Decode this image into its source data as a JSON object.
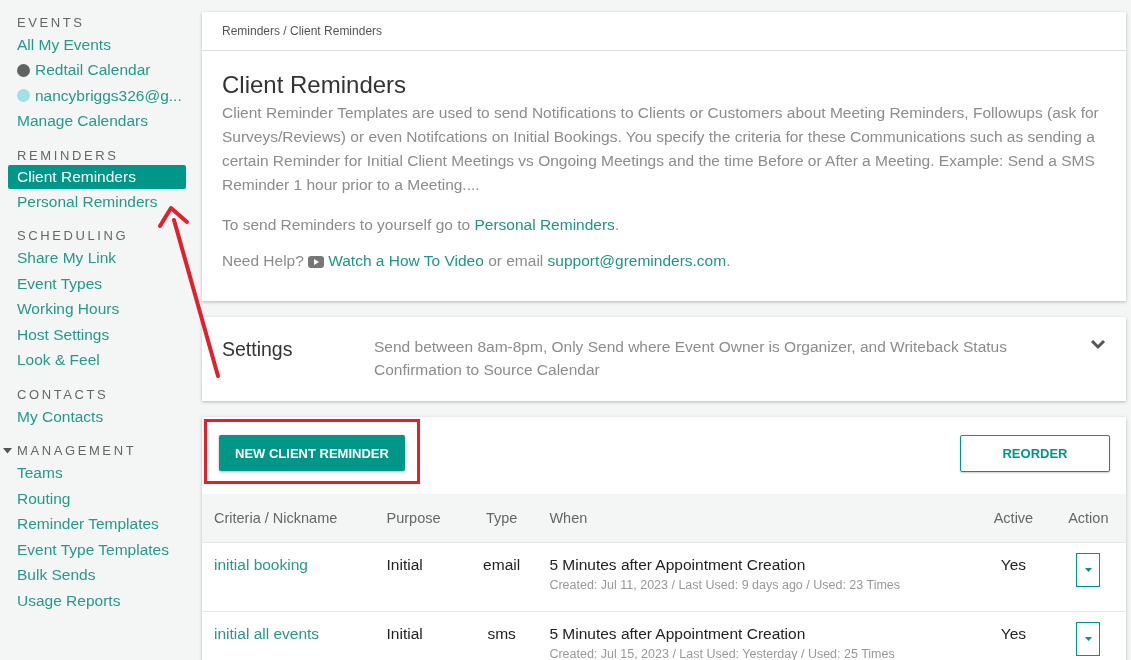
{
  "sidebar": {
    "sections": [
      {
        "heading": "EVENTS",
        "items": [
          {
            "label": "All My Events",
            "selected": false
          },
          {
            "label": "Redtail Calendar",
            "selected": false,
            "color": "#616161"
          },
          {
            "label": "nancybriggs326@g...",
            "selected": false,
            "color": "#a0e1e8"
          },
          {
            "label": "Manage Calendars",
            "selected": false
          }
        ]
      },
      {
        "heading": "REMINDERS",
        "items": [
          {
            "label": "Client Reminders",
            "selected": true
          },
          {
            "label": "Personal Reminders",
            "selected": false
          }
        ]
      },
      {
        "heading": "SCHEDULING",
        "items": [
          {
            "label": "Share My Link",
            "selected": false
          },
          {
            "label": "Event Types",
            "selected": false
          },
          {
            "label": "Working Hours",
            "selected": false
          },
          {
            "label": "Host Settings",
            "selected": false
          },
          {
            "label": "Look & Feel",
            "selected": false
          }
        ]
      },
      {
        "heading": "CONTACTS",
        "items": [
          {
            "label": "My Contacts",
            "selected": false
          }
        ]
      },
      {
        "heading": "MANAGEMENT",
        "expanded": true,
        "items": [
          {
            "label": "Teams",
            "selected": false
          },
          {
            "label": "Routing",
            "selected": false
          },
          {
            "label": "Reminder Templates",
            "selected": false
          },
          {
            "label": "Event Type Templates",
            "selected": false
          },
          {
            "label": "Bulk Sends",
            "selected": false
          },
          {
            "label": "Usage Reports",
            "selected": false
          }
        ]
      }
    ]
  },
  "breadcrumb": "Reminders / Client Reminders",
  "intro": {
    "title": "Client Reminders",
    "description": "Client Reminder Templates are used to send Notifications to Clients or Customers about Meeting Reminders, Followups (ask for Surveys/Reviews) or even Notifcations on Initial Bookings. You specify the criteria for these Communications such as sending a certain Reminder for Initial Client Meetings vs Ongoing Meetings and the time Before or After a Meeting. Example: Send a SMS Reminder 1 hour prior to a Meeting....",
    "personal_line": [
      {
        "kind": "text",
        "text": "To send Reminders to yourself go to "
      },
      {
        "kind": "link",
        "text": "Personal Reminders"
      },
      {
        "kind": "text",
        "text": "."
      }
    ],
    "help_line": [
      {
        "kind": "text",
        "text": "Need Help? "
      },
      {
        "kind": "video",
        "text": "Watch a How To Video"
      },
      {
        "kind": "text",
        "text": " or email "
      },
      {
        "kind": "link",
        "text": "support@greminders.com"
      },
      {
        "kind": "text",
        "text": "."
      }
    ]
  },
  "settings": {
    "title": "Settings",
    "summary": "Send between 8am-8pm, Only Send where Event Owner is Organizer, and Writeback Status Confirmation to Source Calendar",
    "expanded": false
  },
  "new_button": "NEW CLIENT REMINDER",
  "reorder_button": "REORDER",
  "table": {
    "columns": [
      "Criteria / Nickname",
      "Purpose",
      "Type",
      "When",
      "Active",
      "Action"
    ],
    "rows": [
      {
        "criteria": "initial booking",
        "purpose": "Initial",
        "type": "email",
        "when": "5 Minutes after Appointment Creation",
        "details": "Created: Jul 11, 2023 / Last Used: 9 days ago / Used: 23 Times",
        "active": "Yes"
      },
      {
        "criteria": "initial all events",
        "purpose": "Initial",
        "type": "sms",
        "when": "5 Minutes after Appointment Creation",
        "details": "Created: Jul 15, 2023 / Last Used: Yesterday / Used: 25 Times",
        "active": "Yes"
      }
    ]
  }
}
